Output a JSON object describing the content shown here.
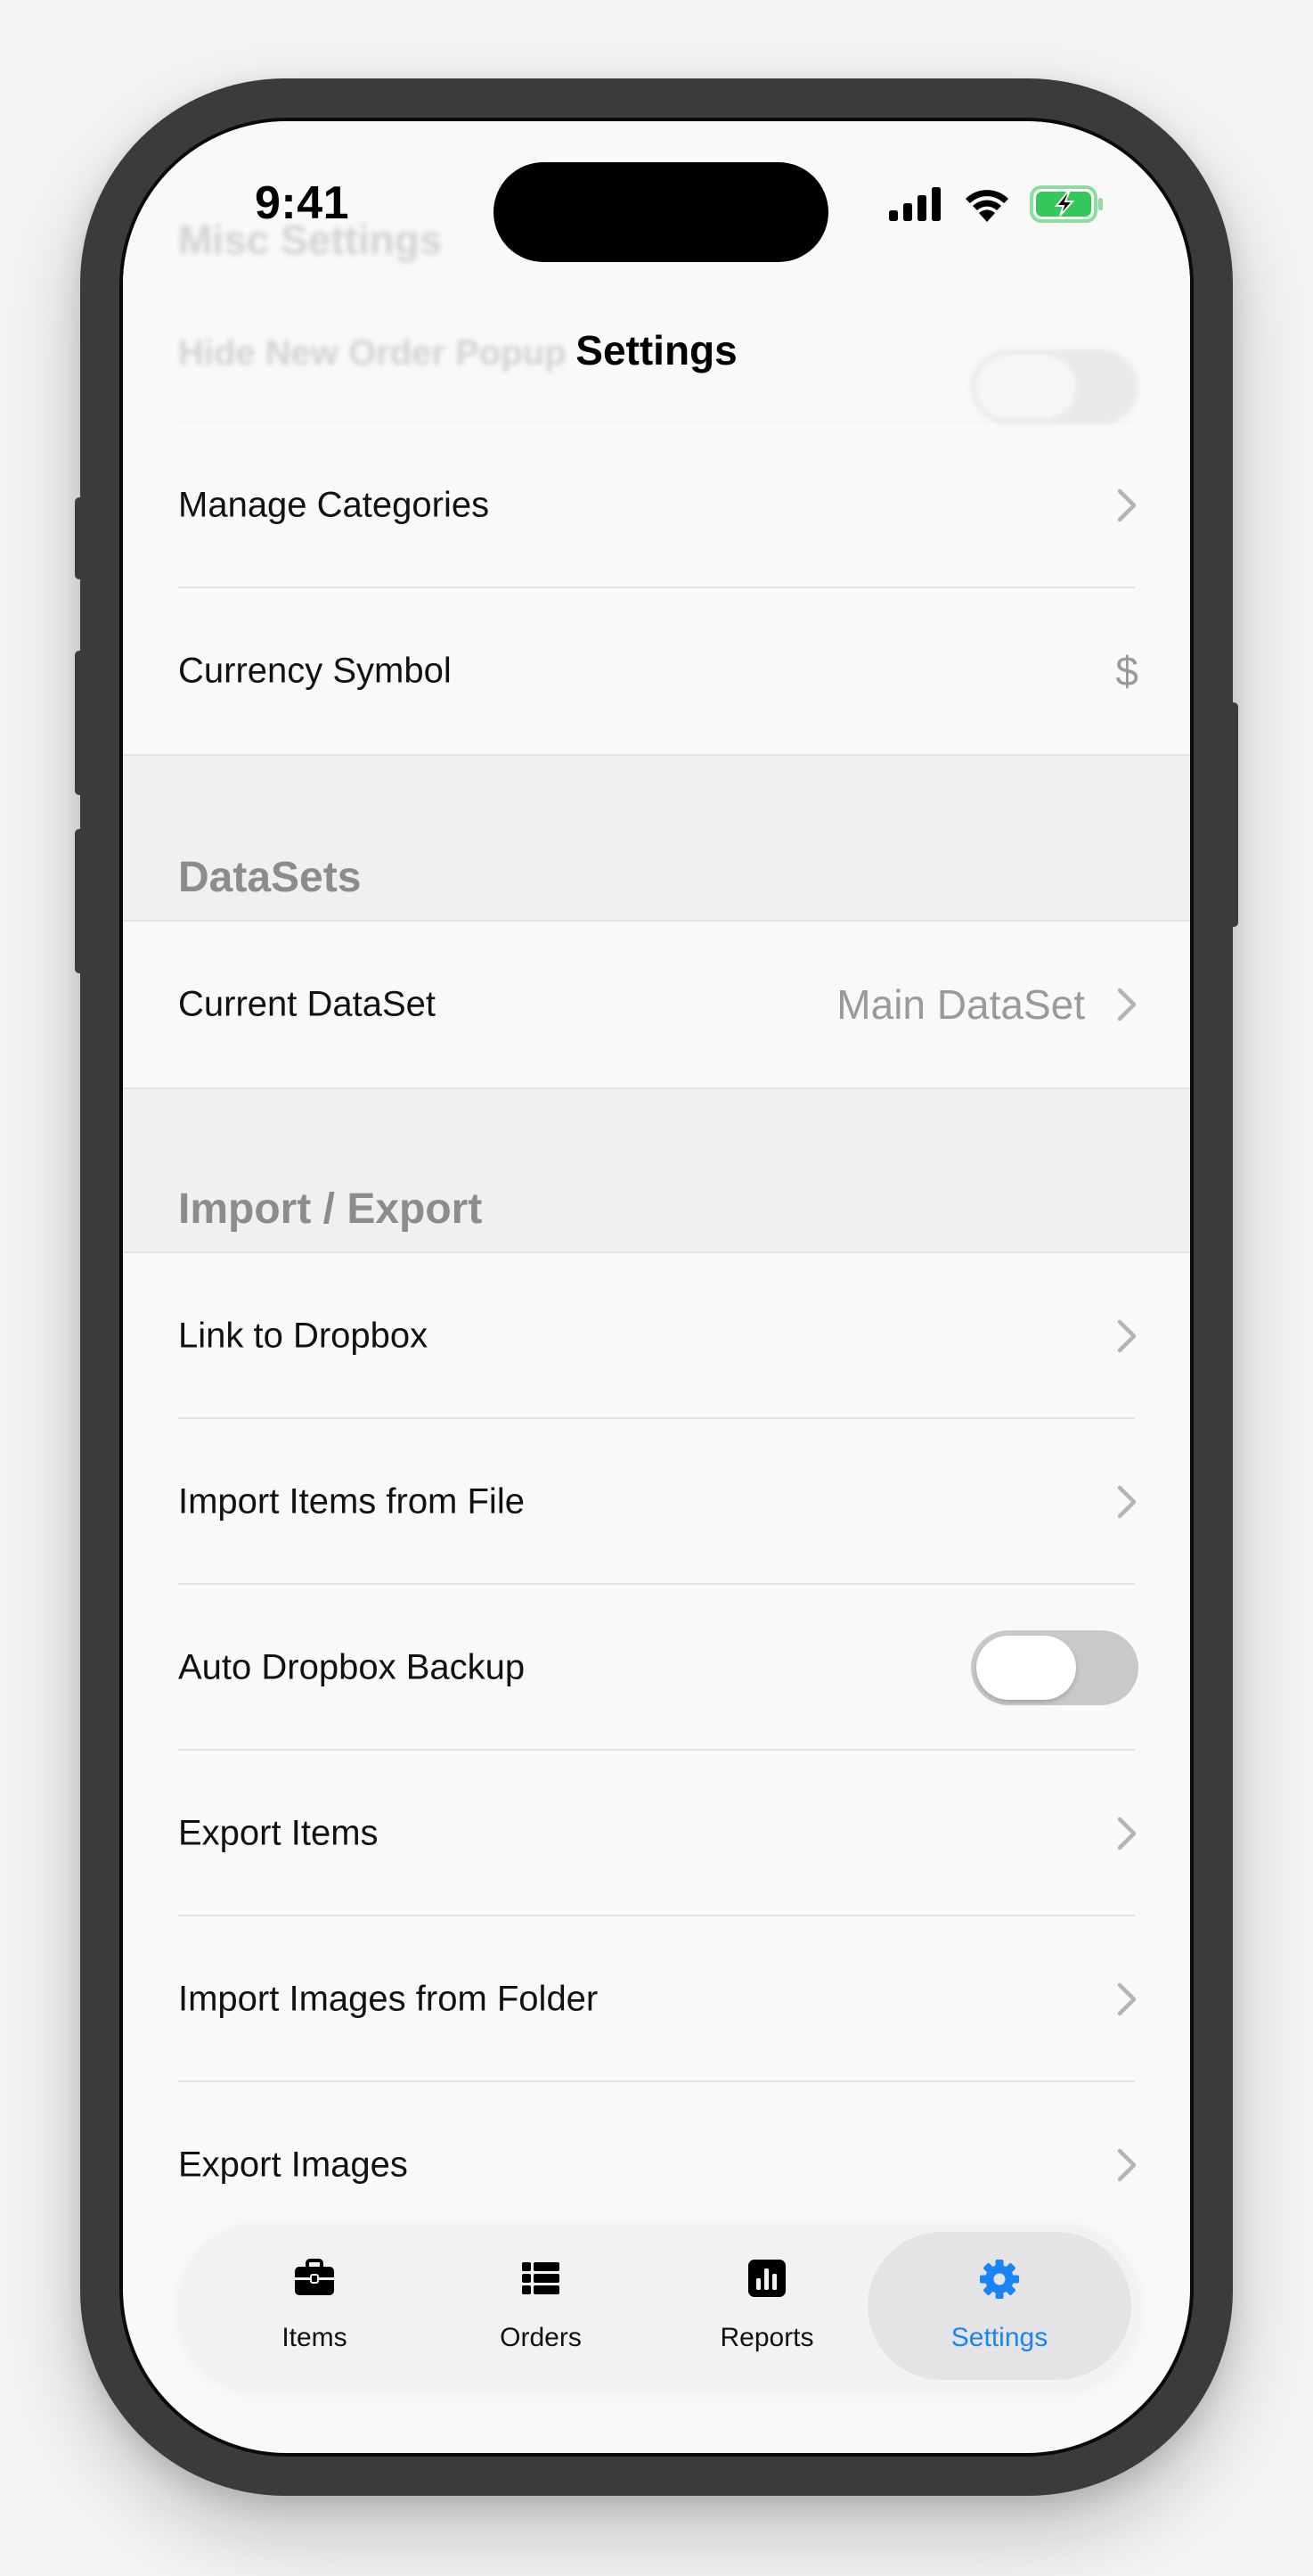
{
  "status_bar": {
    "time": "9:41"
  },
  "nav": {
    "title": "Settings"
  },
  "behind_nav": {
    "section_title": "Misc Settings",
    "row_label": "Hide New Order Popup"
  },
  "rows_top": [
    {
      "label": "Manage Categories",
      "accessory": "chevron"
    },
    {
      "label": "Currency Symbol",
      "value": "$"
    }
  ],
  "sections": {
    "datasets": {
      "title": "DataSets",
      "rows": [
        {
          "label": "Current DataSet",
          "value": "Main DataSet",
          "accessory": "chevron"
        }
      ]
    },
    "import_export": {
      "title": "Import / Export",
      "rows": [
        {
          "label": "Link to Dropbox",
          "accessory": "chevron"
        },
        {
          "label": "Import Items from File",
          "accessory": "chevron"
        },
        {
          "label": "Auto Dropbox Backup",
          "accessory": "toggle",
          "toggle_on": false
        },
        {
          "label": "Export Items",
          "accessory": "chevron"
        },
        {
          "label": "Import Images from Folder",
          "accessory": "chevron"
        },
        {
          "label": "Export Images",
          "accessory": "chevron"
        }
      ]
    }
  },
  "tabbar": {
    "tabs": [
      {
        "label": "Items",
        "icon": "briefcase-icon"
      },
      {
        "label": "Orders",
        "icon": "list-icon"
      },
      {
        "label": "Reports",
        "icon": "bar-chart-icon"
      },
      {
        "label": "Settings",
        "icon": "gear-icon",
        "active": true
      }
    ]
  },
  "colors": {
    "accent": "#1a84f5",
    "battery_green": "#34c759"
  }
}
